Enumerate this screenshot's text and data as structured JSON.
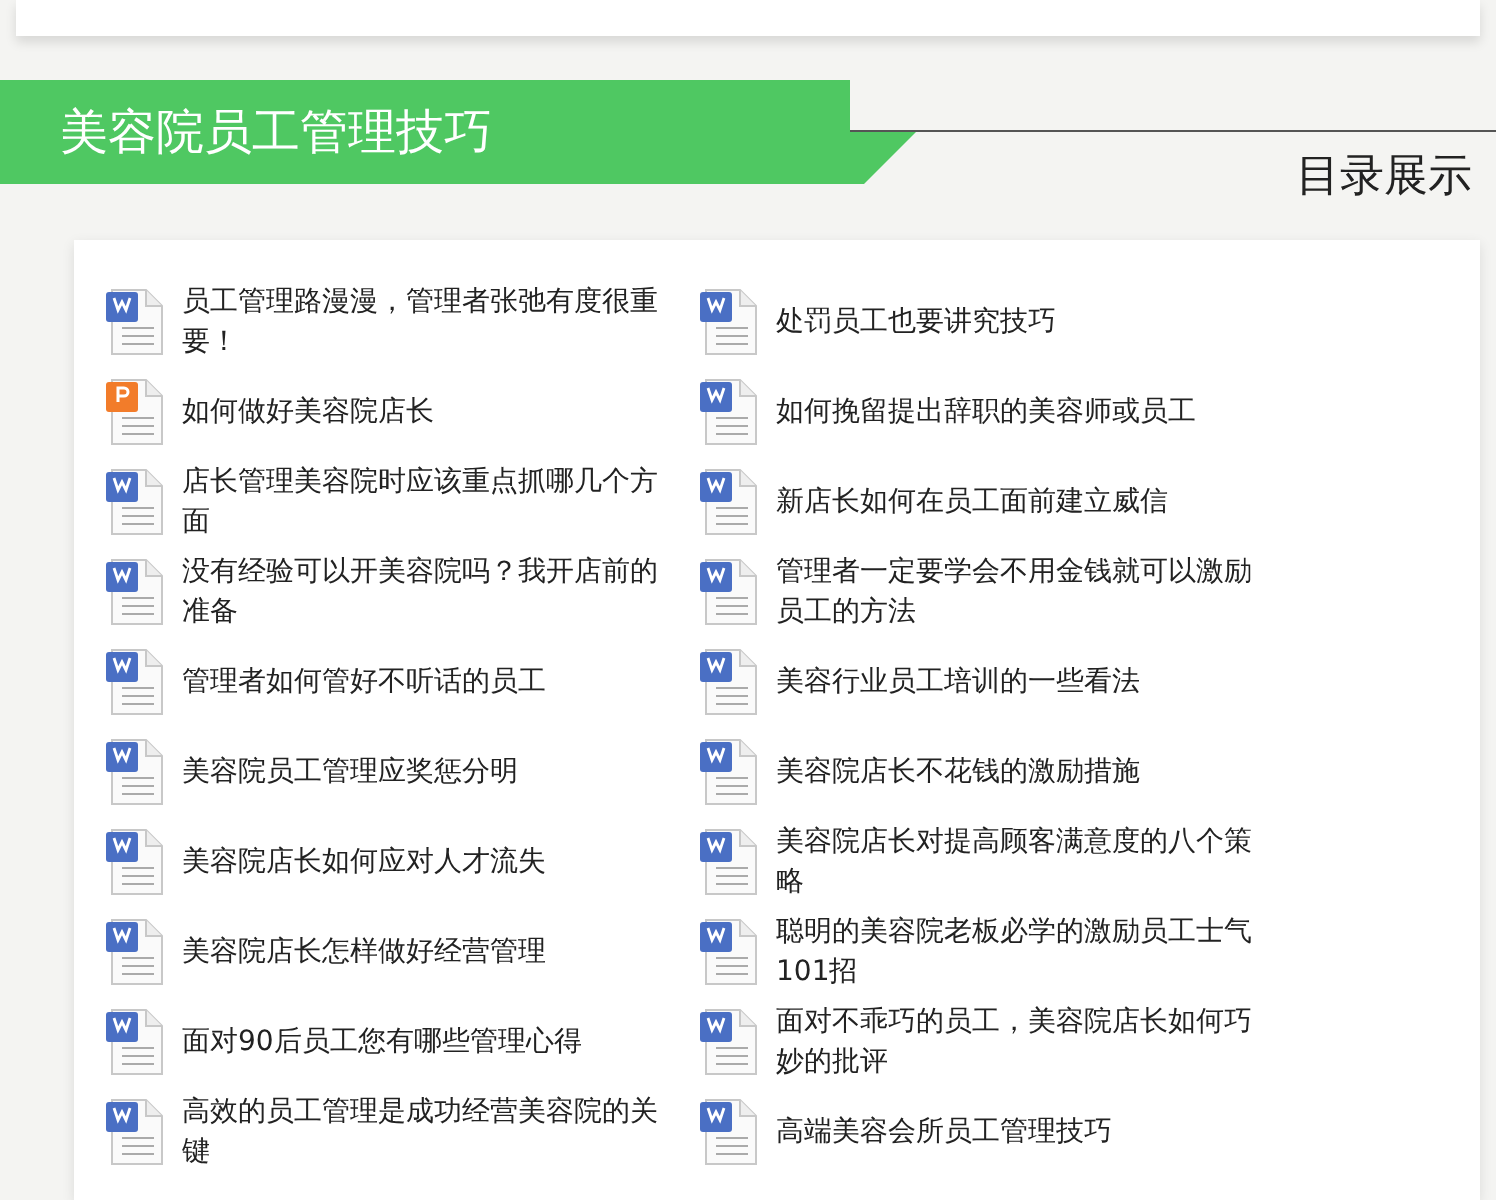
{
  "banner": {
    "title": "美容院员工管理技巧"
  },
  "section_label": "目录展示",
  "documents": [
    {
      "kind": "word",
      "title": "员工管理路漫漫，管理者张弛有度很重要！"
    },
    {
      "kind": "ppt",
      "title": "如何做好美容院店长"
    },
    {
      "kind": "word",
      "title": "店长管理美容院时应该重点抓哪几个方面"
    },
    {
      "kind": "word",
      "title": "没有经验可以开美容院吗？我开店前的准备"
    },
    {
      "kind": "word",
      "title": "管理者如何管好不听话的员工"
    },
    {
      "kind": "word",
      "title": "美容院员工管理应奖惩分明"
    },
    {
      "kind": "word",
      "title": "美容院店长如何应对人才流失"
    },
    {
      "kind": "word",
      "title": "美容院店长怎样做好经营管理"
    },
    {
      "kind": "word",
      "title": "面对90后员工您有哪些管理心得"
    },
    {
      "kind": "word",
      "title": "高效的员工管理是成功经营美容院的关键"
    },
    {
      "kind": "word",
      "title": "处罚员工也要讲究技巧"
    },
    {
      "kind": "word",
      "title": "如何挽留提出辞职的美容师或员工"
    },
    {
      "kind": "word",
      "title": "新店长如何在员工面前建立威信"
    },
    {
      "kind": "word",
      "title": "管理者一定要学会不用金钱就可以激励员工的方法"
    },
    {
      "kind": "word",
      "title": "美容行业员工培训的一些看法"
    },
    {
      "kind": "word",
      "title": "美容院店长不花钱的激励措施"
    },
    {
      "kind": "word",
      "title": "美容院店长对提高顾客满意度的八个策略"
    },
    {
      "kind": "word",
      "title": "聪明的美容院老板必学的激励员工士气101招"
    },
    {
      "kind": "word",
      "title": "面对不乖巧的员工，美容院店长如何巧妙的批评"
    },
    {
      "kind": "word",
      "title": "高端美容会所员工管理技巧"
    }
  ]
}
